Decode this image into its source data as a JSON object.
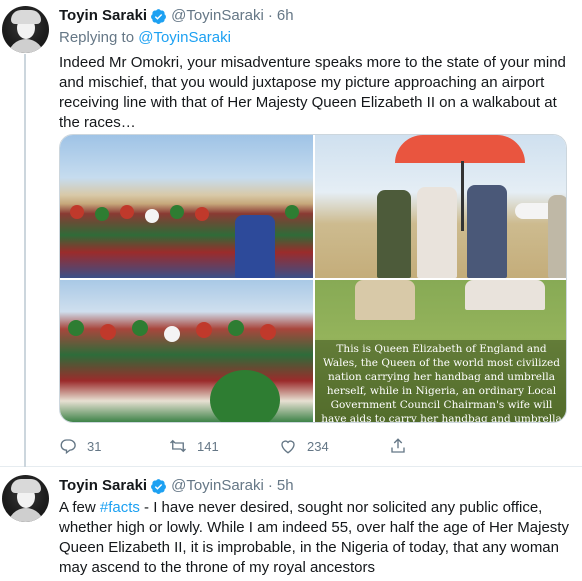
{
  "tweets": [
    {
      "author_name": "Toyin Saraki",
      "author_handle": "@ToyinSaraki",
      "time": "6h",
      "separator": "·",
      "replying_to_label": "Replying to",
      "replying_to_handle": "@ToyinSaraki",
      "text": "Indeed Mr Omokri, your misadventure speaks more to the state of your mind and mischief, that you would juxtapose my picture approaching an airport receiving line with that of Her Majesty Queen Elizabeth II on a walkabout at the races…",
      "media_caption": "This is Queen Elizabeth of England and Wales, the Queen of the world most civilized nation carrying her handbag and umbrella herself, while in Nigeria, an ordinary Local Government Council Chairman's wife will have aids to carry her handbag and umbrella for her. Nigerians, where did we get it wrong?",
      "reply_count": "31",
      "retweet_count": "141",
      "like_count": "234"
    },
    {
      "author_name": "Toyin Saraki",
      "author_handle": "@ToyinSaraki",
      "time": "5h",
      "separator": "·",
      "text_prefix": "A few ",
      "hashtag": "#facts",
      "text_rest": " - I have never desired, sought nor solicited any public office, whether high or lowly. While I am indeed 55, over half the age of Her Majesty Queen Elizabeth II, it is improbable, in the Nigeria of today, that any woman may ascend to the throne of my royal ancestors"
    }
  ],
  "icons": {
    "verified": "verified-badge-icon",
    "reply": "reply-icon",
    "retweet": "retweet-icon",
    "like": "heart-icon",
    "share": "share-icon"
  },
  "colors": {
    "link": "#1da1f2",
    "secondary_text": "#657786",
    "verified": "#1da1f2",
    "divider": "#e6ecf0"
  }
}
